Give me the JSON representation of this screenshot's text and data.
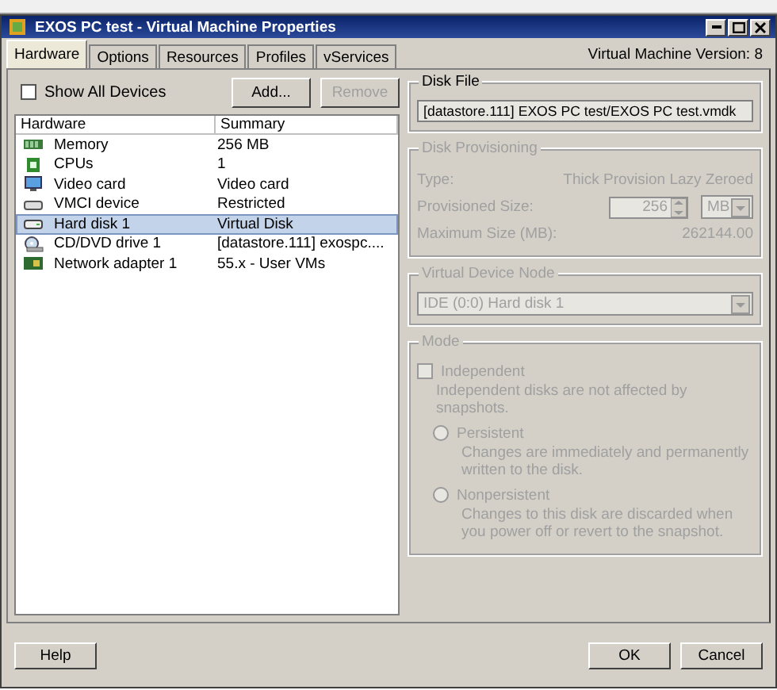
{
  "window": {
    "title": "EXOS PC test - Virtual Machine Properties"
  },
  "tabs": [
    {
      "label": "Hardware",
      "selected": true
    },
    {
      "label": "Options",
      "selected": false
    },
    {
      "label": "Resources",
      "selected": false
    },
    {
      "label": "Profiles",
      "selected": false
    },
    {
      "label": "vServices",
      "selected": false
    }
  ],
  "version": "Virtual Machine Version: 8",
  "show_all_devices": {
    "label": "Show All Devices",
    "checked": false
  },
  "add_button": {
    "label": "Add...",
    "disabled": false
  },
  "remove_button": {
    "label": "Remove",
    "disabled": true
  },
  "table": {
    "columns": [
      "Hardware",
      "Summary"
    ],
    "rows": [
      {
        "kind": "memory",
        "hardware": "Memory",
        "summary": "256 MB",
        "selected": false
      },
      {
        "kind": "cpu",
        "hardware": "CPUs",
        "summary": "1",
        "selected": false
      },
      {
        "kind": "video",
        "hardware": "Video card",
        "summary": "Video card",
        "selected": false
      },
      {
        "kind": "device",
        "hardware": "VMCI device",
        "summary": "Restricted",
        "selected": false
      },
      {
        "kind": "disk",
        "hardware": "Hard disk 1",
        "summary": "Virtual Disk",
        "selected": true
      },
      {
        "kind": "cdrom",
        "hardware": "CD/DVD drive 1",
        "summary": "[datastore.111] exospc....",
        "selected": false
      },
      {
        "kind": "network",
        "hardware": "Network adapter 1",
        "summary": "55.x - User VMs",
        "selected": false
      }
    ]
  },
  "disk_file": {
    "title": "Disk File",
    "value": "[datastore.111] EXOS PC test/EXOS PC test.vmdk"
  },
  "disk_provisioning": {
    "title": "Disk Provisioning",
    "disabled": true,
    "type_label": "Type:",
    "type_value": "Thick Provision Lazy Zeroed",
    "size_label": "Provisioned Size:",
    "size_value": "256",
    "unit": "MB",
    "max_label": "Maximum Size (MB):",
    "max_value": "262144.00"
  },
  "virtual_device_node": {
    "title": "Virtual Device Node",
    "disabled": true,
    "value": "IDE (0:0) Hard disk 1"
  },
  "mode": {
    "title": "Mode",
    "disabled": true,
    "independent": {
      "label": "Independent",
      "checked": false,
      "description": "Independent disks are not affected by snapshots."
    },
    "options": [
      {
        "label": "Persistent",
        "selected": false,
        "description": "Changes are immediately and permanently written to the disk."
      },
      {
        "label": "Nonpersistent",
        "selected": false,
        "description": "Changes to this disk are discarded when you power off or revert to the snapshot."
      }
    ]
  },
  "buttons": {
    "help": "Help",
    "ok": "OK",
    "cancel": "Cancel"
  }
}
